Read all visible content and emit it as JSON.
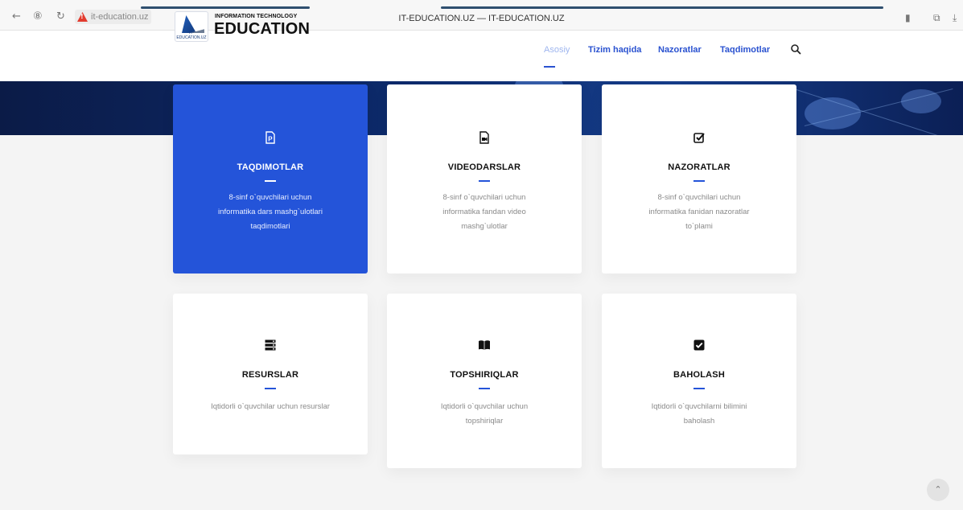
{
  "browser": {
    "url": "it-education.uz",
    "window_title": "IT-EDUCATION.UZ — IT-EDUCATION.UZ",
    "icons": [
      "back-icon",
      "tracking-icon",
      "reload-icon",
      "warning-icon",
      "bookmark-icon",
      "extensions-icon",
      "download-icon"
    ]
  },
  "header": {
    "logo_tag": "IT-EDUCATION.UZ",
    "logo_small": "INFORMATION TECHNOLOGY",
    "logo_big": "EDUCATION",
    "menu": [
      {
        "label": "Asosiy",
        "active": true
      },
      {
        "label": "Tizim haqida",
        "active": false
      },
      {
        "label": "Nazoratlar",
        "active": false
      },
      {
        "label": "Taqdimotlar",
        "active": false
      }
    ]
  },
  "cards": [
    {
      "title": "TAQDIMOTLAR",
      "desc1": "8-sinf o`quvchilari uchun",
      "desc2": "informatika dars mashg`ulotlari",
      "desc3": "taqdimotlari",
      "icon": "presentation-file-icon"
    },
    {
      "title": "VIDEODARSLAR",
      "desc1": "8-sinf o`quvchilari uchun",
      "desc2": "informatika fandan video",
      "desc3": "mashg`ulotlar",
      "icon": "video-file-icon"
    },
    {
      "title": "NAZORATLAR",
      "desc1": "8-sinf o`quvchilari uchun",
      "desc2": "informatika fanidan nazoratlar",
      "desc3": "to`plami",
      "icon": "checked-box-icon"
    },
    {
      "title": "RESURSLAR",
      "desc1": "Iqtidorli o`quvchilar uchun resurslar",
      "desc2": "",
      "desc3": "",
      "icon": "server-stack-icon"
    },
    {
      "title": "TOPSHIRIQLAR",
      "desc1": "Iqtidorli o`quvchilar uchun",
      "desc2": "topshiriqlar",
      "desc3": "",
      "icon": "open-book-icon"
    },
    {
      "title": "BAHOLASH",
      "desc1": "Iqtidorli o`quvchilarni bilimini",
      "desc2": "baholash",
      "desc3": "",
      "icon": "filled-check-icon"
    }
  ],
  "colors": {
    "accent": "#2454d9",
    "menu_active": "#9fb6ef",
    "hero_dark": "#0b1b47"
  }
}
